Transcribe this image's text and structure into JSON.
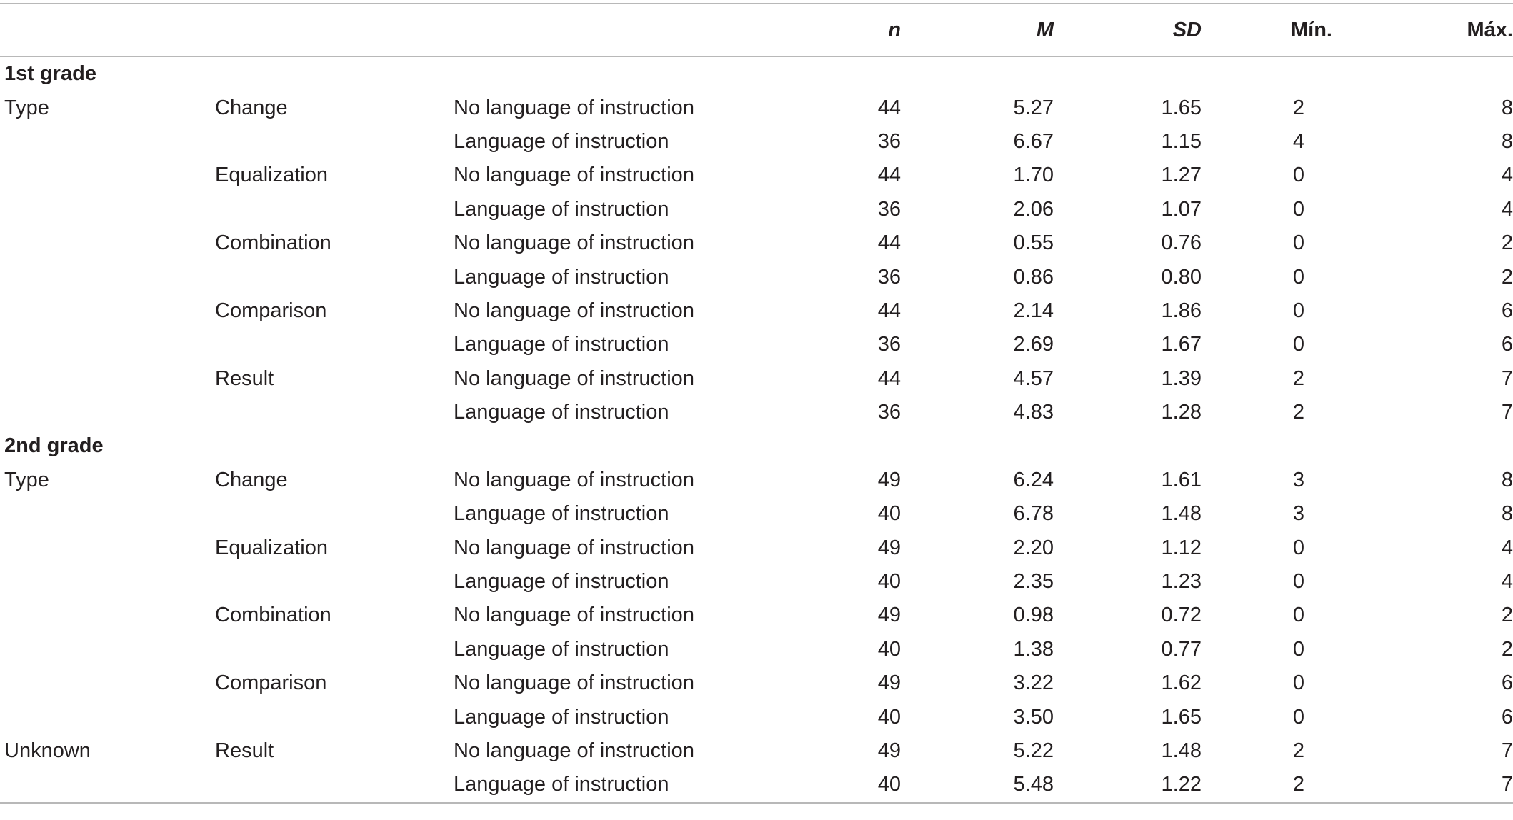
{
  "header": {
    "n": "n",
    "m": "M",
    "sd": "SD",
    "min": "Mín.",
    "max": "Máx."
  },
  "sections": [
    {
      "title": "1st grade",
      "rows": [
        {
          "c1": "Type",
          "c2": "Change",
          "c3": "No language of instruction",
          "n": "44",
          "m": "5.27",
          "sd": "1.65",
          "min": "2",
          "max": "8"
        },
        {
          "c1": "",
          "c2": "",
          "c3": "Language of instruction",
          "n": "36",
          "m": "6.67",
          "sd": "1.15",
          "min": "4",
          "max": "8"
        },
        {
          "c1": "",
          "c2": "Equalization",
          "c3": "No language of instruction",
          "n": "44",
          "m": "1.70",
          "sd": "1.27",
          "min": "0",
          "max": "4"
        },
        {
          "c1": "",
          "c2": "",
          "c3": "Language of instruction",
          "n": "36",
          "m": "2.06",
          "sd": "1.07",
          "min": "0",
          "max": "4"
        },
        {
          "c1": "",
          "c2": "Combination",
          "c3": "No language of instruction",
          "n": "44",
          "m": "0.55",
          "sd": "0.76",
          "min": "0",
          "max": "2"
        },
        {
          "c1": "",
          "c2": "",
          "c3": "Language of instruction",
          "n": "36",
          "m": "0.86",
          "sd": "0.80",
          "min": "0",
          "max": "2"
        },
        {
          "c1": "",
          "c2": "Comparison",
          "c3": "No language of instruction",
          "n": "44",
          "m": "2.14",
          "sd": "1.86",
          "min": "0",
          "max": "6"
        },
        {
          "c1": "",
          "c2": "",
          "c3": "Language of instruction",
          "n": "36",
          "m": "2.69",
          "sd": "1.67",
          "min": "0",
          "max": "6"
        },
        {
          "c1": "",
          "c2": "Result",
          "c3": "No language of instruction",
          "n": "44",
          "m": "4.57",
          "sd": "1.39",
          "min": "2",
          "max": "7"
        },
        {
          "c1": "",
          "c2": "",
          "c3": "Language of instruction",
          "n": "36",
          "m": "4.83",
          "sd": "1.28",
          "min": "2",
          "max": "7"
        }
      ]
    },
    {
      "title": "2nd grade",
      "rows": [
        {
          "c1": "Type",
          "c2": "Change",
          "c3": "No language of instruction",
          "n": "49",
          "m": "6.24",
          "sd": "1.61",
          "min": "3",
          "max": "8"
        },
        {
          "c1": "",
          "c2": "",
          "c3": "Language of instruction",
          "n": "40",
          "m": "6.78",
          "sd": "1.48",
          "min": "3",
          "max": "8"
        },
        {
          "c1": "",
          "c2": "Equalization",
          "c3": "No language of instruction",
          "n": "49",
          "m": "2.20",
          "sd": "1.12",
          "min": "0",
          "max": "4"
        },
        {
          "c1": "",
          "c2": "",
          "c3": "Language of instruction",
          "n": "40",
          "m": "2.35",
          "sd": "1.23",
          "min": "0",
          "max": "4"
        },
        {
          "c1": "",
          "c2": "Combination",
          "c3": "No language of instruction",
          "n": "49",
          "m": "0.98",
          "sd": "0.72",
          "min": "0",
          "max": "2"
        },
        {
          "c1": "",
          "c2": "",
          "c3": "Language of instruction",
          "n": "40",
          "m": "1.38",
          "sd": "0.77",
          "min": "0",
          "max": "2"
        },
        {
          "c1": "",
          "c2": "Comparison",
          "c3": "No language of instruction",
          "n": "49",
          "m": "3.22",
          "sd": "1.62",
          "min": "0",
          "max": "6"
        },
        {
          "c1": "",
          "c2": "",
          "c3": "Language of instruction",
          "n": "40",
          "m": "3.50",
          "sd": "1.65",
          "min": "0",
          "max": "6"
        },
        {
          "c1": "Unknown",
          "c2": "Result",
          "c3": "No language of instruction",
          "n": "49",
          "m": "5.22",
          "sd": "1.48",
          "min": "2",
          "max": "7"
        },
        {
          "c1": "",
          "c2": "",
          "c3": "Language of instruction",
          "n": "40",
          "m": "5.48",
          "sd": "1.22",
          "min": "2",
          "max": "7"
        }
      ]
    }
  ]
}
